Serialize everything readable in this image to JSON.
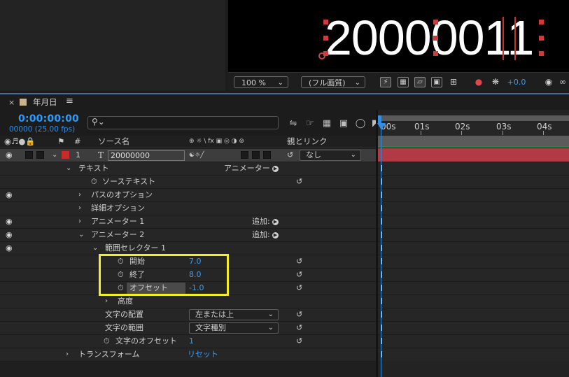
{
  "viewer": {
    "text": "20000011",
    "zoom": "100 %",
    "resolution": "(フル画質)",
    "exposure": "+0.0"
  },
  "panel": {
    "close": "×",
    "comp_name": "年月日",
    "menu": "≡",
    "timecode": "0:00:00:00",
    "frames": "00000 (25.00 fps)",
    "search_icon": "⚲"
  },
  "columns": {
    "number": "#",
    "source_name": "ソース名",
    "switches": "⊕ ☼ \\ fx ▣ ◎ ◑ ⊚",
    "parent_link": "親とリンク"
  },
  "layer": {
    "index": "1",
    "type_glyph": "T",
    "name": "20000000",
    "parent": "なし"
  },
  "rows": {
    "text": "テキスト",
    "animator_label": "アニメーター :",
    "source_text": "ソーステキスト",
    "path_options": "パスのオプション",
    "more_options": "詳細オプション",
    "animator1": "アニメーター 1",
    "animator2": "アニメーター 2",
    "add1": "追加:",
    "add2": "追加:",
    "range_selector": "範囲セレクター 1",
    "start_label": "開始",
    "start_value": "7.0",
    "end_label": "終了",
    "end_value": "8.0",
    "offset_label": "オフセット",
    "offset_value": "-1.0",
    "advanced": "高度",
    "text_placement": "文字の配置",
    "text_placement_value": "左または上",
    "text_range": "文字の範囲",
    "text_range_value": "文字種別",
    "char_offset": "文字のオフセット",
    "char_offset_value": "1",
    "transform": "トランスフォーム",
    "reset": "リセット"
  },
  "timeline": {
    "ticks": [
      "00s",
      "01s",
      "02s",
      "03s",
      "04s"
    ]
  },
  "colors": {
    "accent": "#2f9bf4",
    "layer_bar": "#b13b44",
    "highlight": "#f0ee2c",
    "label": "#c72c2c"
  }
}
